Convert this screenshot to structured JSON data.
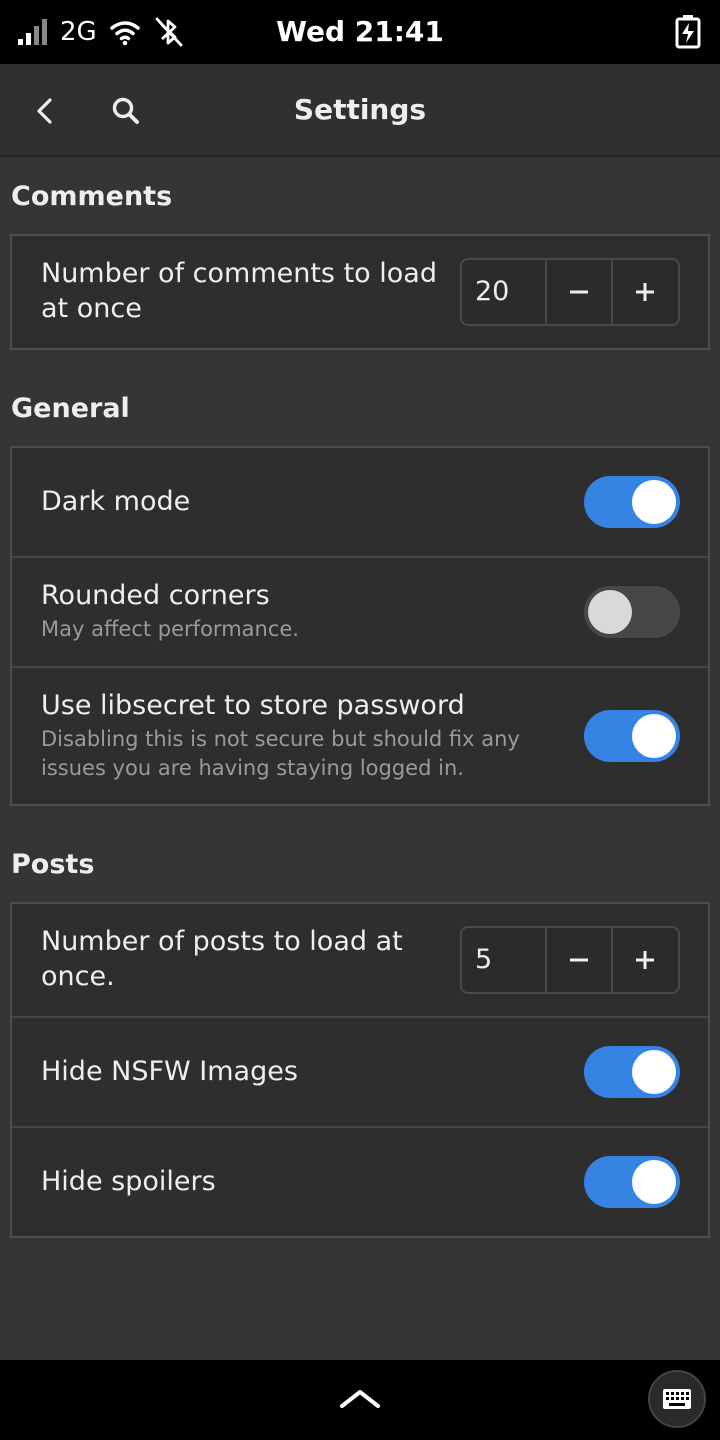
{
  "status_bar": {
    "network": "2G",
    "time": "Wed 21:41",
    "icons": [
      "signal-icon",
      "wifi-icon",
      "bluetooth-off-icon",
      "battery-charging-icon"
    ]
  },
  "header": {
    "title": "Settings",
    "icons": [
      "back-arrow-icon",
      "search-icon"
    ]
  },
  "sections": {
    "comments": {
      "title": "Comments",
      "rows": [
        {
          "title": "Number of comments to load at once",
          "value": "20"
        }
      ]
    },
    "general": {
      "title": "General",
      "rows": [
        {
          "title": "Dark mode",
          "enabled": true
        },
        {
          "title": "Rounded corners",
          "subtitle": "May affect performance.",
          "enabled": false
        },
        {
          "title": "Use libsecret to store password",
          "subtitle": "Disabling this is not secure but should fix any issues you are having staying logged in.",
          "enabled": true
        }
      ]
    },
    "posts": {
      "title": "Posts",
      "rows": [
        {
          "title": "Number of posts to load at once.",
          "value": "5"
        },
        {
          "title": "Hide NSFW Images",
          "enabled": true
        },
        {
          "title": "Hide spoilers",
          "enabled": true
        }
      ]
    }
  },
  "spin_labels": {
    "minus": "−",
    "plus": "+"
  },
  "colors": {
    "accent": "#3584e4",
    "background": "#353535",
    "switch_off": "#474747"
  },
  "bottom_bar": {
    "icons": [
      "chevron-up-icon",
      "keyboard-icon"
    ]
  }
}
